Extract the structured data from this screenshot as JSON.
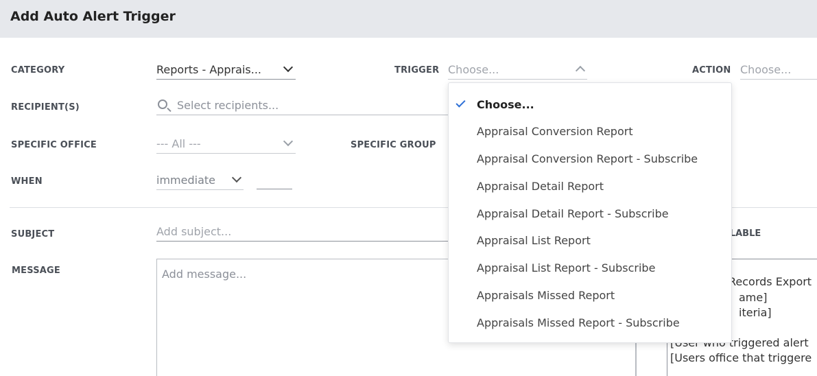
{
  "header": {
    "title": "Add Auto Alert Trigger"
  },
  "form": {
    "category": {
      "label": "CATEGORY",
      "value": "Reports - Apprais..."
    },
    "trigger": {
      "label": "TRIGGER",
      "placeholder": "Choose..."
    },
    "action": {
      "label": "ACTION",
      "placeholder": "Choose..."
    },
    "recipients": {
      "label": "RECIPIENT(S)",
      "placeholder": "Select recipients..."
    },
    "specific_office": {
      "label": "SPECIFIC OFFICE",
      "value": "--- All ---"
    },
    "specific_group": {
      "label": "SPECIFIC GROUP"
    },
    "when": {
      "label": "WHEN",
      "value": "immediate"
    },
    "subject": {
      "label": "SUBJECT",
      "placeholder": "Add subject..."
    },
    "message": {
      "label": "MESSAGE",
      "placeholder": "Add message..."
    },
    "available": {
      "label_fragment": "ILABLE"
    },
    "variables": [
      "Records Export",
      "ame]",
      "iteria]",
      "[User who triggered alert",
      "[Users office that triggere"
    ]
  },
  "trigger_dropdown": {
    "selected_index": 0,
    "options": [
      "Choose...",
      "Appraisal Conversion Report",
      "Appraisal Conversion Report - Subscribe",
      "Appraisal Detail Report",
      "Appraisal Detail Report - Subscribe",
      "Appraisal List Report",
      "Appraisal List Report - Subscribe",
      "Appraisals Missed Report",
      "Appraisals Missed Report - Subscribe"
    ]
  },
  "colors": {
    "header_bg": "#e6e8ec",
    "check_accent": "#2d6fd6",
    "label": "#4a4f57"
  }
}
